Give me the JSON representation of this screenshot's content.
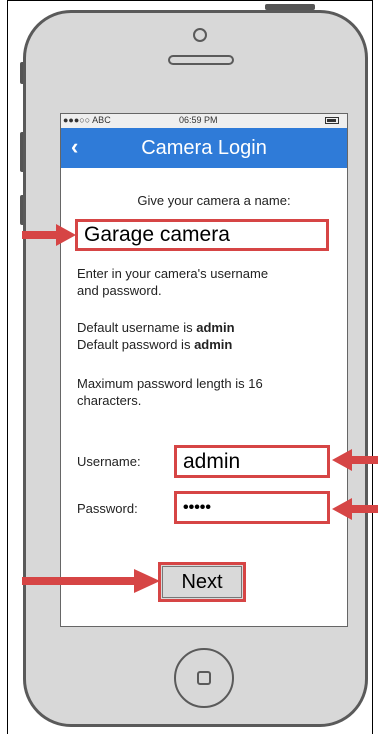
{
  "status_bar": {
    "carrier": "●●●○○ ABC",
    "time": "06:59 PM"
  },
  "nav": {
    "back_icon": "‹",
    "title": "Camera Login"
  },
  "form": {
    "name_prompt": "Give your camera a name:",
    "camera_name_value": "Garage camera",
    "instructions_line1": "Enter in your camera's username",
    "instructions_line2": "and password.",
    "default_user_prefix": "Default username is ",
    "default_user_value": "admin",
    "default_pass_prefix": "Default password is ",
    "default_pass_value": "admin",
    "max_length_line1": "Maximum password length is 16",
    "max_length_line2": "characters.",
    "username_label": "Username:",
    "username_value": "admin",
    "password_label": "Password:",
    "password_value": "•••••",
    "next_label": "Next"
  },
  "colors": {
    "accent": "#2f7bd8",
    "highlight": "#d64545"
  }
}
